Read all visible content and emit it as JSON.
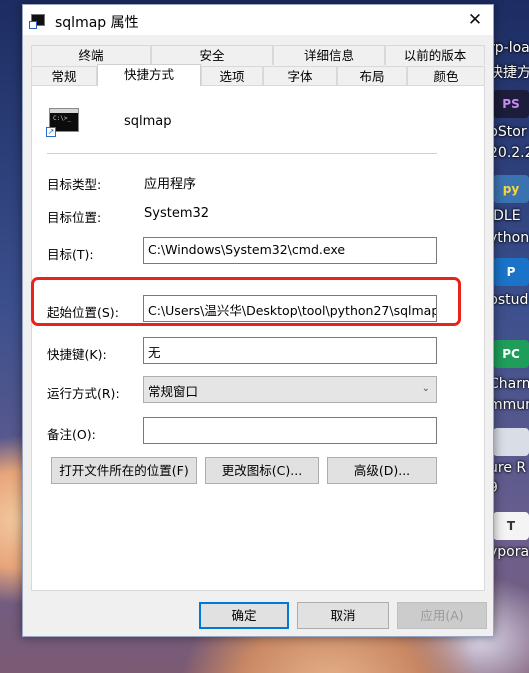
{
  "window": {
    "title": "sqlmap 属性",
    "close_glyph": "✕"
  },
  "tabs_top": [
    "终端",
    "安全",
    "详细信息",
    "以前的版本"
  ],
  "tabs_bottom": [
    "常规",
    "快捷方式",
    "选项",
    "字体",
    "布局",
    "颜色"
  ],
  "active_tab": "快捷方式",
  "shortcut": {
    "name": "sqlmap",
    "icon_text": "C:\\>_"
  },
  "fields": {
    "target_type_label": "目标类型:",
    "target_type_value": "应用程序",
    "target_location_label": "目标位置:",
    "target_location_value": "System32",
    "target_label": "目标(T):",
    "target_value": "C:\\Windows\\System32\\cmd.exe",
    "start_in_label": "起始位置(S):",
    "start_in_value": "C:\\Users\\温兴华\\Desktop\\tool\\python27\\sqlmap",
    "shortcut_key_label": "快捷键(K):",
    "shortcut_key_value": "无",
    "run_label": "运行方式(R):",
    "run_value": "常规窗口",
    "comment_label": "备注(O):",
    "comment_value": ""
  },
  "buttons": {
    "open_location": "打开文件所在的位置(F)",
    "change_icon": "更改图标(C)...",
    "advanced": "高级(D)...",
    "ok": "确定",
    "cancel": "取消",
    "apply": "应用(A)"
  },
  "desktop": {
    "items": [
      {
        "label": "rp-loa",
        "sub": "快捷方"
      },
      {
        "label": "pStor",
        "sub": "20.2.2",
        "icon": "PS"
      },
      {
        "label": "IDLE",
        "sub": "ython",
        "icon": "py"
      },
      {
        "label": "pstud",
        "icon": "P"
      },
      {
        "label": "Charm",
        "sub": "mmun",
        "icon": "PC"
      },
      {
        "label": "ure R",
        "sub": "9"
      },
      {
        "label": "ypora",
        "icon": "T"
      }
    ]
  },
  "colors": {
    "highlight": "#e8231c",
    "accent": "#0078d7"
  }
}
